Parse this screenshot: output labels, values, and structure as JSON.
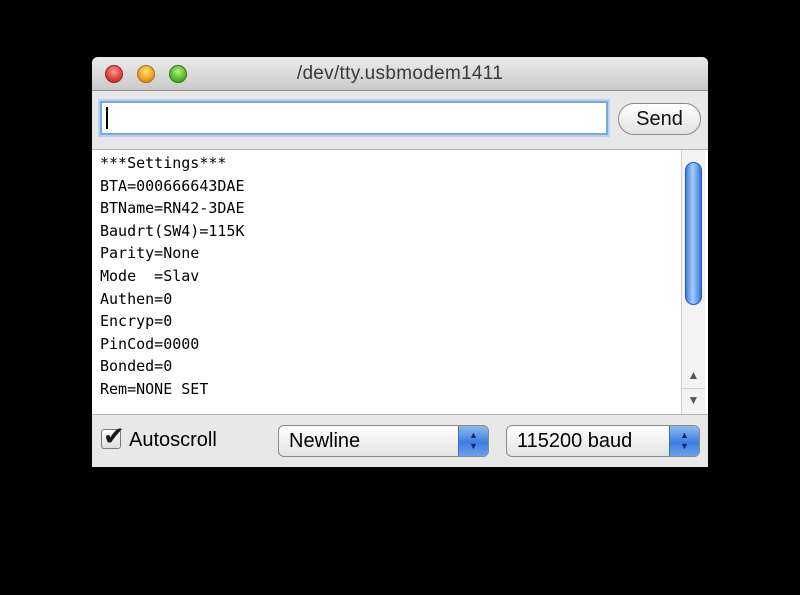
{
  "window": {
    "title": "/dev/tty.usbmodem1411"
  },
  "input": {
    "value": "",
    "send_label": "Send"
  },
  "output": {
    "lines": [
      "***Settings***",
      "BTA=000666643DAE",
      "BTName=RN42-3DAE",
      "Baudrt(SW4)=115K",
      "Parity=None",
      "Mode  =Slav",
      "Authen=0",
      "Encryp=0",
      "PinCod=0000",
      "Bonded=0",
      "Rem=NONE SET"
    ]
  },
  "footer": {
    "autoscroll_label": "Autoscroll",
    "autoscroll_checked": true,
    "line_ending": "Newline",
    "baud_rate": "115200 baud"
  },
  "icons": {
    "close": "close-icon",
    "minimize": "minimize-icon",
    "zoom": "zoom-icon",
    "check": "checkmark-icon",
    "scroll_up": "arrow-up-icon",
    "scroll_down": "arrow-down-icon"
  },
  "colors": {
    "focus_ring": "#7aa7e0",
    "scroll_thumb": "#5a98ea",
    "background": "#000000"
  }
}
